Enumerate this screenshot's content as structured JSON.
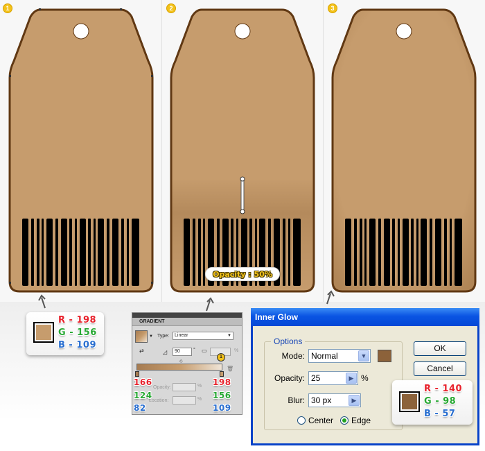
{
  "steps": [
    "1",
    "2",
    "3"
  ],
  "colors": {
    "tag_fill": "#c69c6d",
    "tag_stroke": "#603813",
    "glow_color": "#8c623a",
    "opacity_yellow": "#f3c21a"
  },
  "swatch_main": {
    "color": "#c69c6d",
    "r": "R - 198",
    "g": "G - 156",
    "b": "B - 109"
  },
  "gradient_panel": {
    "title": "GRADIENT",
    "type_label": "Type:",
    "type_value": "Linear",
    "angle_value": "90",
    "degree_symbol": "°",
    "location_badge": "1",
    "opacity_label": "Opacity:",
    "location_label": "Location:",
    "percent": "%",
    "left_stop": {
      "r": "166",
      "g": "124",
      "b": "82"
    },
    "right_stop": {
      "r": "198",
      "g": "156",
      "b": "109"
    }
  },
  "opacity_note": "Opacity : 50%",
  "inner_glow_dialog": {
    "title": "Inner Glow",
    "options_legend": "Options",
    "mode_label": "Mode:",
    "mode_value": "Normal",
    "opacity_label": "Opacity:",
    "opacity_value": "25",
    "opacity_unit": "%",
    "blur_label": "Blur:",
    "blur_value": "30 px",
    "center_label": "Center",
    "edge_label": "Edge",
    "selected_source": "Edge",
    "ok_label": "OK",
    "cancel_label": "Cancel"
  },
  "swatch_glow": {
    "color": "#8c623a",
    "r": "R - 140",
    "g": "G - 98",
    "b": "B - 57"
  }
}
